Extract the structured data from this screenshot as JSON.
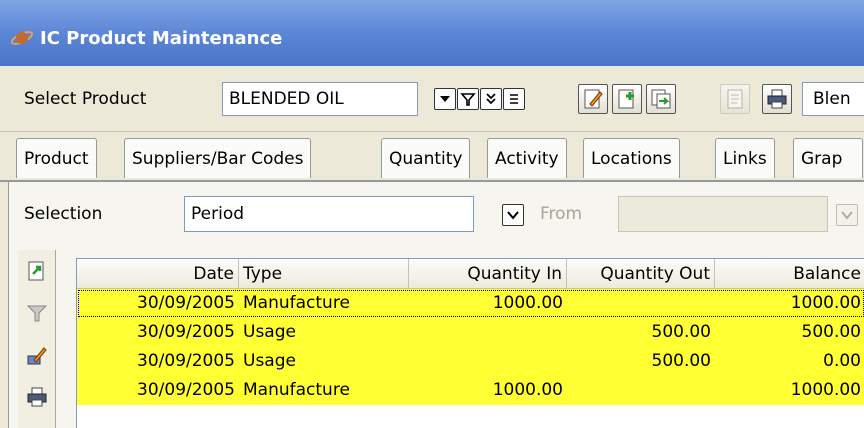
{
  "window": {
    "title": "IC Product Maintenance",
    "app_icon": "planet-icon"
  },
  "toolbar": {
    "select_product_label": "Select Product",
    "product_value": "BLENDED OIL",
    "description_value": "Blen",
    "icons": [
      "dropdown-icon",
      "filter-icon",
      "expand-icon",
      "list-icon",
      "edit-icon",
      "new-icon",
      "copy-icon",
      "document-icon",
      "print-icon"
    ]
  },
  "tabs": [
    "Product",
    "Suppliers/Bar Codes",
    "Quantity",
    "Activity",
    "Locations",
    "Links",
    "Grap"
  ],
  "selection": {
    "label": "Selection",
    "value": "Period",
    "from_label": "From",
    "from_value": ""
  },
  "grid": {
    "columns": [
      "Date",
      "Type",
      "Quantity In",
      "Quantity Out",
      "Balance"
    ],
    "rows": [
      {
        "date": "30/09/2005",
        "type": "Manufacture",
        "qty_in": "1000.00",
        "qty_out": "",
        "balance": "1000.00"
      },
      {
        "date": "30/09/2005",
        "type": "Usage",
        "qty_in": "",
        "qty_out": "500.00",
        "balance": "500.00"
      },
      {
        "date": "30/09/2005",
        "type": "Usage",
        "qty_in": "",
        "qty_out": "500.00",
        "balance": "0.00"
      },
      {
        "date": "30/09/2005",
        "type": "Manufacture",
        "qty_in": "1000.00",
        "qty_out": "",
        "balance": "1000.00"
      }
    ],
    "row_color": "#FFFF33",
    "side_icons": [
      "refresh-icon",
      "filter-icon",
      "edit-icon",
      "print-icon"
    ]
  }
}
